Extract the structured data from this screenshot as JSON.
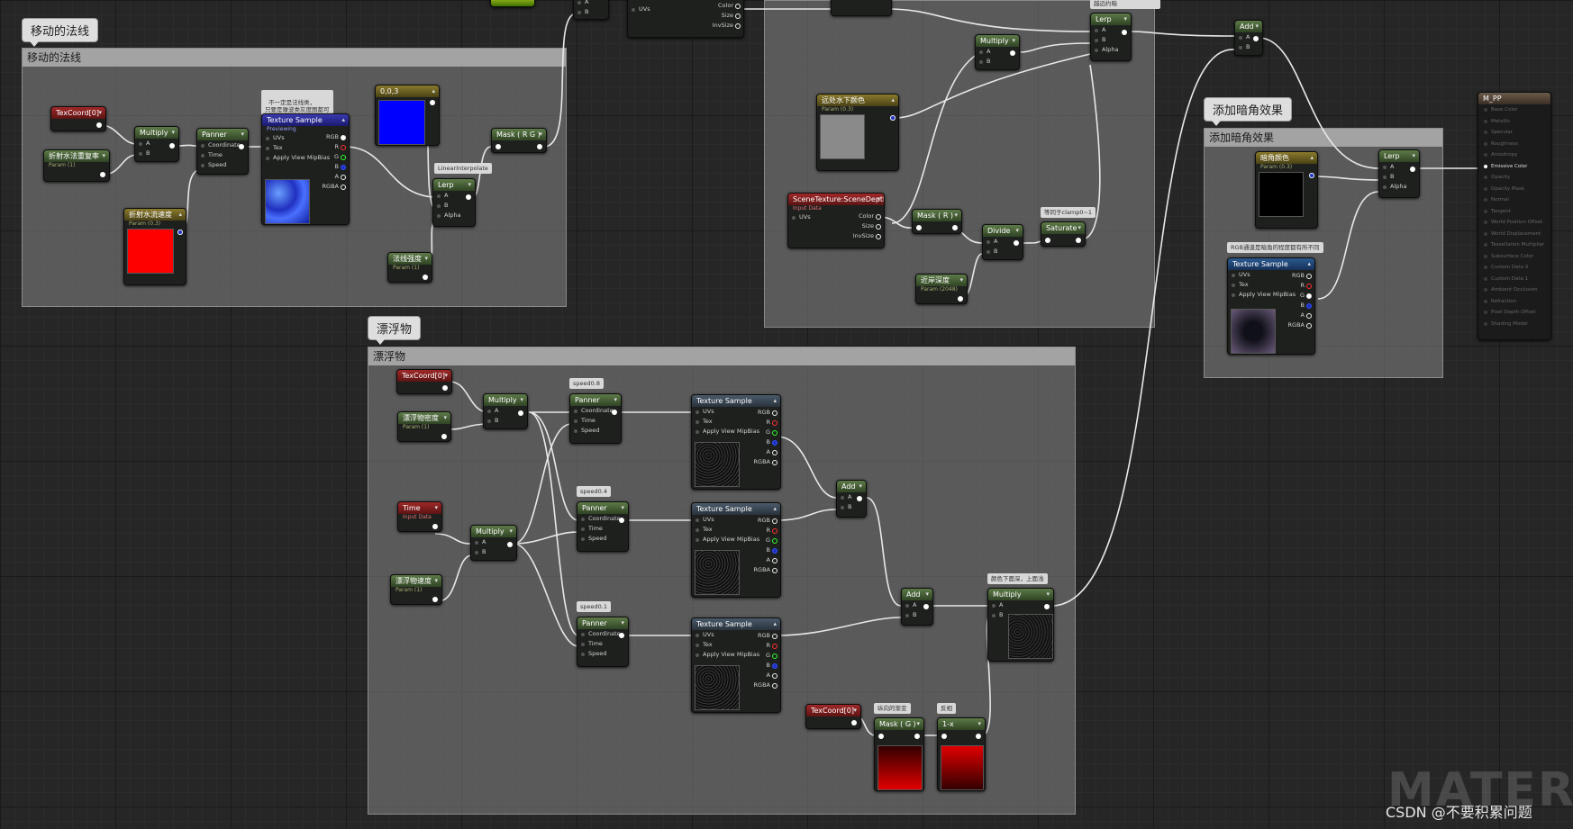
{
  "comments": {
    "moving_normals": "移动的法线",
    "floating": "漂浮物",
    "dark_corner": "添加暗角效果"
  },
  "notes": {
    "not_necessarily_normal": "不一定是法线类，\n只要是噪波类灰度图都可",
    "linear_interpolate": "LinearInterpolate",
    "more_distance": "越远约暗",
    "clamp": "等同于clamp0~1",
    "speed08": "speed0.8",
    "speed04": "speed0.4",
    "speed01": "speed0.1",
    "color_darker": "颜色下面深，上面浅",
    "vertical_gradient": "纵向的渐变",
    "invert": "反相",
    "rgb_sampling": "RGB通道是暗角的程度都有所不同"
  },
  "nodes": {
    "texcoord0": "TexCoord[0]",
    "multiply": "Multiply",
    "panner": "Panner",
    "texture_sample": "Texture Sample",
    "previewing": "Previewing",
    "const3": "0,0,3",
    "mask_rg": "Mask ( R G )",
    "mask_r": "Mask ( R )",
    "mask_g": "Mask ( G )",
    "lerp": "Lerp",
    "add": "Add",
    "divide": "Divide",
    "saturate": "Saturate",
    "one_minus": "1-x",
    "time": "Time",
    "input_data": "Input Data",
    "refraction_tiling": "折射水法重复率",
    "refraction_speed": "折射水流速度",
    "normal_strength": "法线强度",
    "float_density": "漂浮物密度",
    "float_speed": "漂浮物速度",
    "shallow_color": "远处水下颜色",
    "scene_depth": "SceneTexture:SceneDepth",
    "shore_depth": "近岸深度",
    "dark_color": "暗角颜色",
    "param_label": "Param (1)",
    "param2_label": "Param (0.3)",
    "param3_label": "Param (2048)",
    "material_name": "M_PP"
  },
  "pins": {
    "a": "A",
    "b": "B",
    "alpha": "Alpha",
    "coordinate": "Coordinate",
    "time": "Time",
    "speed": "Speed",
    "uvs": "UVs",
    "tex": "Tex",
    "apply_mip": "Apply View MipBias",
    "rgb": "RGB",
    "r": "R",
    "g": "G",
    "b_ch": "B",
    "a_ch": "A",
    "rgba": "RGBA",
    "color": "Color",
    "size": "Size",
    "invsize": "InvSize"
  },
  "material_pins": [
    "Base Color",
    "Metallic",
    "Specular",
    "Roughness",
    "Anisotropy",
    "Emissive Color",
    "Opacity",
    "Opacity Mask",
    "Normal",
    "Tangent",
    "World Position Offset",
    "World Displacement",
    "Tessellation Multiplier",
    "Subsurface Color",
    "Custom Data 0",
    "Custom Data 1",
    "Ambient Occlusion",
    "Refraction",
    "Pixel Depth Offset",
    "Shading Model"
  ],
  "watermark": "MATERI",
  "credit": "CSDN @不要积累问题",
  "colors": {
    "accent_red": "#ff0000",
    "accent_blue": "#0000ff"
  }
}
